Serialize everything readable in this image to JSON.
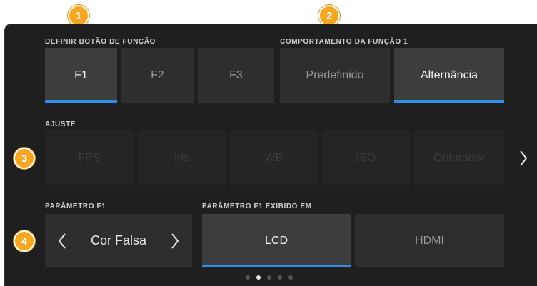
{
  "function_button": {
    "label": "DEFINIR BOTÃO DE FUNÇÃO",
    "buttons": [
      "F1",
      "F2",
      "F3"
    ],
    "selected": "F1"
  },
  "function_behavior": {
    "label": "COMPORTAMENTO DA FUNÇÃO 1",
    "options": [
      "Predefinido",
      "Alternância"
    ],
    "selected": "Alternância"
  },
  "adjust": {
    "label": "AJUSTE",
    "options": [
      "FPS",
      "Iris",
      "WB",
      "ISO",
      "Obturador"
    ],
    "next_icon": "chevron-right-icon"
  },
  "parameter": {
    "label": "PARÂMETRO F1",
    "value": "Cor Falsa",
    "prev_icon": "chevron-left-icon",
    "next_icon": "chevron-right-icon"
  },
  "parameter_display": {
    "label": "PARÂMETRO F1 EXIBIDO EM",
    "options": [
      "LCD",
      "HDMI"
    ],
    "selected": "LCD"
  },
  "badges": [
    "1",
    "2",
    "3",
    "4"
  ],
  "pagination": {
    "total": 5,
    "current": 2
  },
  "colors": {
    "accent": "#2f8ee8",
    "badge": "#f5a623",
    "background": "#1f1f1f"
  }
}
